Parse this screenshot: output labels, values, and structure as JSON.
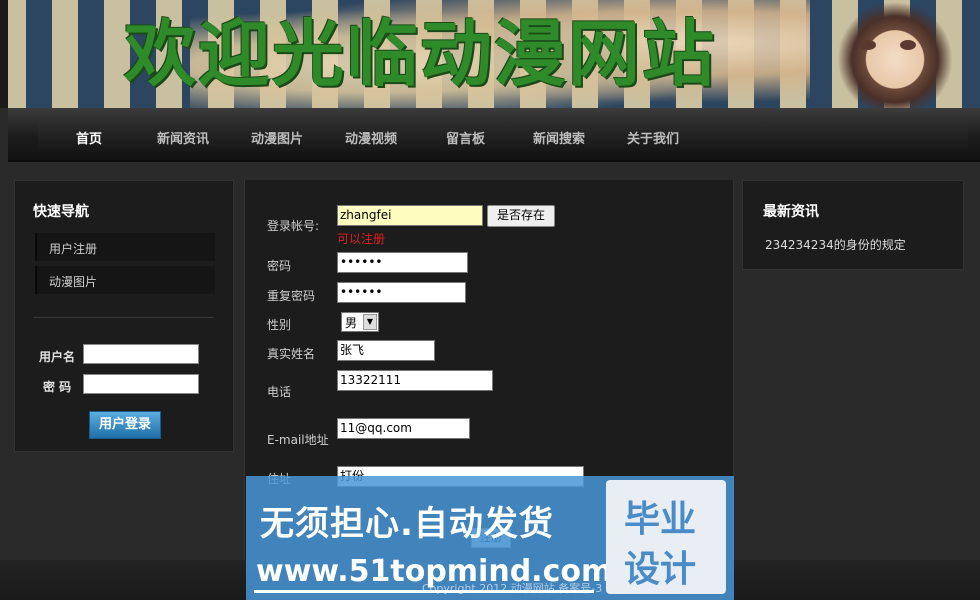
{
  "banner": {
    "title": "欢迎光临动漫网站"
  },
  "nav": {
    "items": [
      "首页",
      "新闻资讯",
      "动漫图片",
      "动漫视频",
      "留言板",
      "新闻搜索",
      "关于我们"
    ]
  },
  "left": {
    "title": "快速导航",
    "links": [
      "用户注册",
      "动漫图片"
    ],
    "username_label": "用户名",
    "password_label": "密 码",
    "login_button": "用户登录"
  },
  "form": {
    "account_label": "登录帐号:",
    "account_value": "zhangfei",
    "check_button": "是否存在",
    "available_msg": "可以注册",
    "password_label": "密码",
    "password_value": "••••••",
    "repeat_label": "重复密码",
    "repeat_value": "••••••",
    "gender_label": "性别",
    "gender_value": "男",
    "realname_label": "真实姓名",
    "realname_value": "张飞",
    "phone_label": "电话",
    "phone_value": "13322111",
    "email_label": "E-mail地址",
    "email_value": "11@qq.com",
    "address_label": "住址",
    "address_value": "打份",
    "submit_label": "注册"
  },
  "right": {
    "title": "最新资讯",
    "news": [
      "234234234的身份的规定"
    ]
  },
  "watermark": {
    "line1": "无须担心.自动发货",
    "line2": "www.51topmind.com",
    "box1": "毕业",
    "box2": "设计",
    "faint": "Copyright 2012 动漫网站 备案号-3"
  },
  "colors": {
    "banner_title": "#2f8a2a",
    "available_msg": "#e02020",
    "watermark": "#4696d7"
  }
}
